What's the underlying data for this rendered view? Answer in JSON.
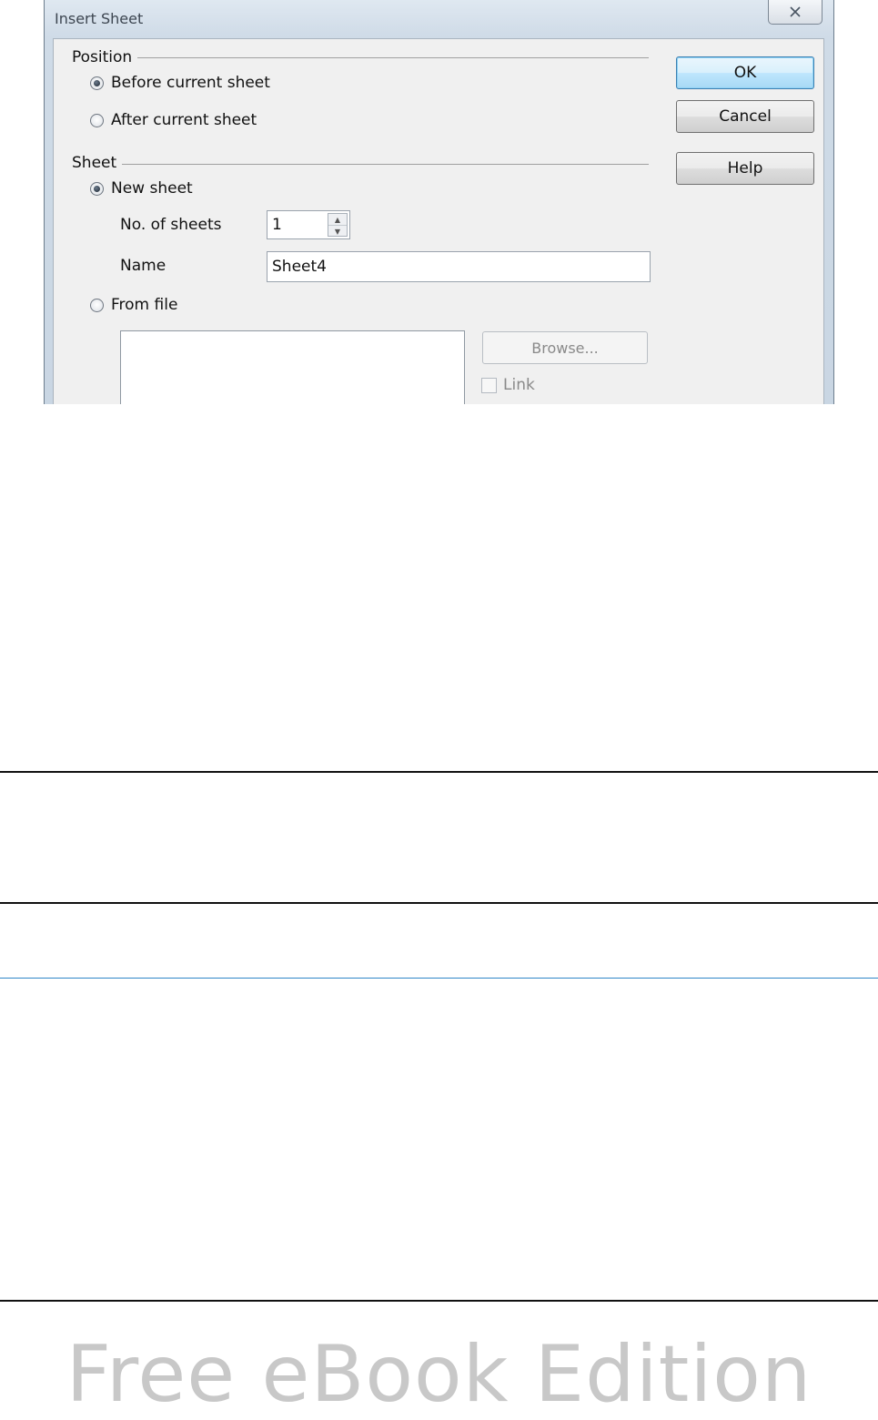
{
  "dialog": {
    "title": "Insert Sheet",
    "position": {
      "group_label": "Position",
      "before_label": "Before current sheet",
      "after_label": "After current sheet",
      "selected": "before"
    },
    "sheet": {
      "group_label": "Sheet",
      "new_sheet_label": "New sheet",
      "no_of_sheets_label": "No. of sheets",
      "no_of_sheets_value": "1",
      "name_label": "Name",
      "name_value": "Sheet4",
      "from_file_label": "From file",
      "selected": "new"
    },
    "browse_label": "Browse...",
    "link_label": "Link",
    "buttons": {
      "ok": "OK",
      "cancel": "Cancel",
      "help": "Help"
    }
  },
  "watermark": "Free eBook Edition",
  "colors": {
    "default_button_border": "#3c7fb1",
    "rule_blue": "#2f86c7",
    "watermark": "#c8c8c8"
  }
}
